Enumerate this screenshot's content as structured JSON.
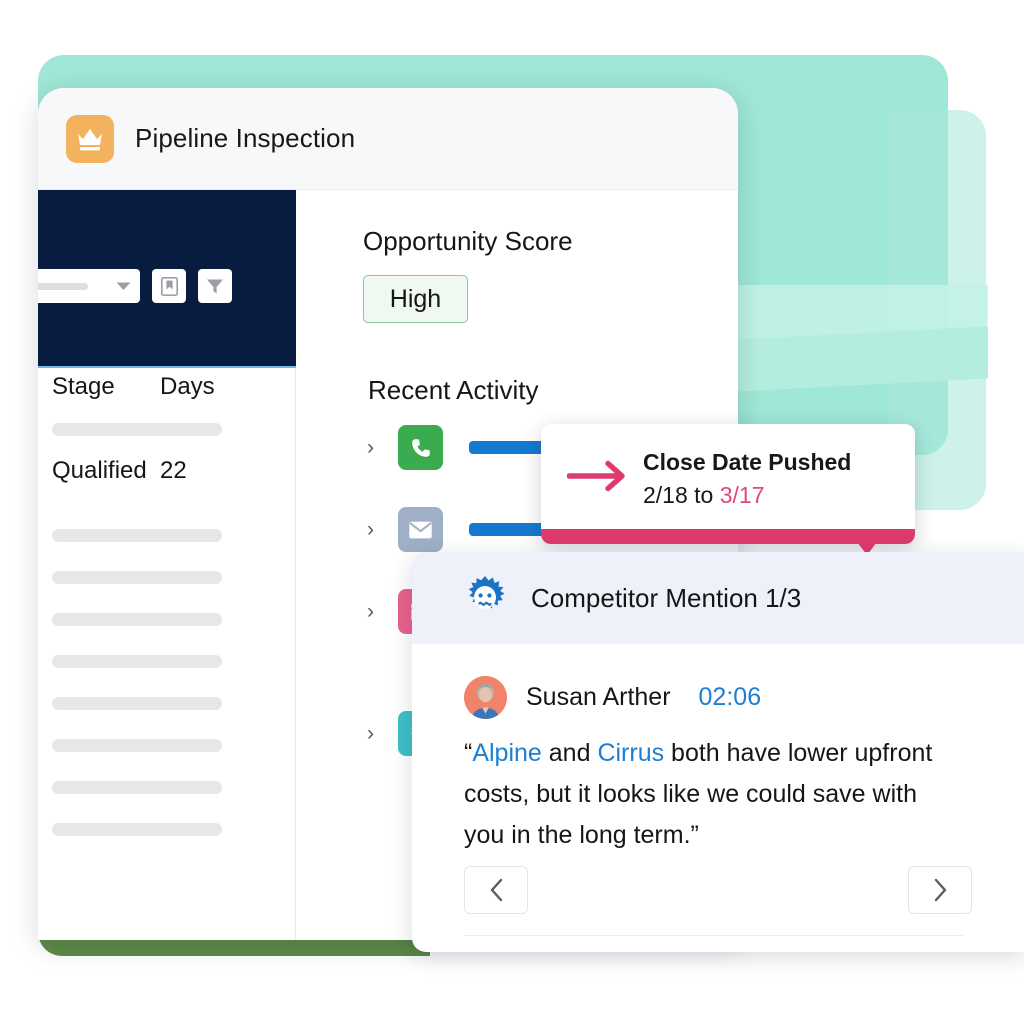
{
  "app": {
    "title": "Pipeline Inspection",
    "icon": "crown-icon"
  },
  "sidebar": {
    "select": {
      "placeholder": "",
      "chevron": "chevron-down-icon"
    },
    "buttons": [
      {
        "name": "bookmark-icon",
        "label": "Bookmark"
      },
      {
        "name": "filter-icon",
        "label": "Filter"
      }
    ],
    "table": {
      "columns": [
        "Stage",
        "Days"
      ],
      "rows": [
        {
          "stage": "Qualified",
          "days": "22"
        }
      ],
      "skeleton_row_count": 8
    }
  },
  "main": {
    "opportunity_score_label": "Opportunity Score",
    "opportunity_score_value": "High",
    "recent_activity_label": "Recent Activity",
    "activities": [
      {
        "icon": "phone-call-icon",
        "color": "#3aab4f",
        "expander": "chevron-right-icon",
        "has_bar": true
      },
      {
        "icon": "email-icon",
        "color": "#9eafc6",
        "expander": "chevron-right-icon",
        "has_bar": true
      },
      {
        "icon": "calendar-icon",
        "color": "#e8628c",
        "expander": "chevron-right-icon",
        "has_bar": false
      },
      {
        "icon": "contact-book-icon",
        "color": "#3dc0c7",
        "expander": "chevron-right-icon",
        "has_bar": false
      }
    ]
  },
  "callout": {
    "icon": "arrow-right-icon",
    "line1": "Close Date Pushed",
    "old_date": "2/18 to ",
    "new_date": "3/17",
    "accent_color": "#dd3a6e",
    "new_date_color": "#e04a77"
  },
  "competitor_mention": {
    "icon": "einstein-mascot-icon",
    "title": "Competitor Mention 1/3",
    "speaker": "Susan Arther",
    "timestamp": "02:06",
    "quote": {
      "open_quote": "“",
      "brand1": "Alpine",
      "mid1": " and ",
      "brand2": "Cirrus",
      "rest": " both have lower upfront costs, but it looks like we could save with you in the long term.”",
      "brand_color": "#1d7fd4"
    },
    "prev_label": "chevron-left-icon",
    "next_label": "chevron-right-icon"
  },
  "colors": {
    "mint_background": "#9fe7d6",
    "navy_panel": "#081c3f",
    "green_footer": "#5d8b47",
    "blue_bar": "#1679d1",
    "score_green": "#88ca93",
    "app_icon_orange": "#f3b35e"
  }
}
